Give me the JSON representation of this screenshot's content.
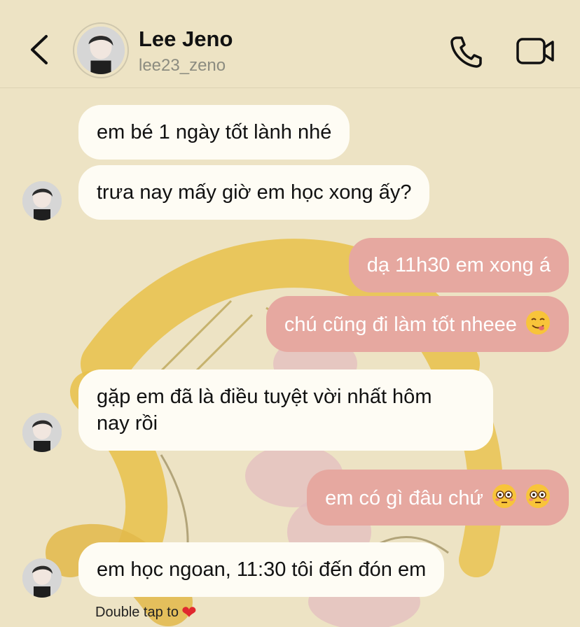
{
  "header": {
    "name": "Lee Jeno",
    "username": "lee23_zeno"
  },
  "messages": [
    {
      "side": "in",
      "text": "em bé 1 ngày tốt lành nhé"
    },
    {
      "side": "in",
      "text": "trưa nay mấy giờ em học xong ấy?"
    },
    {
      "side": "out",
      "text": "dạ 11h30 em xong á"
    },
    {
      "side": "out",
      "text": "chú cũng đi làm tốt nheee",
      "emoji": "yum-face-emoji"
    },
    {
      "side": "in",
      "text_line1": "gặp em đã là điều tuyệt vời nhất hôm",
      "text_line2": "nay rồi"
    },
    {
      "side": "out",
      "text": "em có gì đâu chứ",
      "emoji": "flushed-face-emoji"
    },
    {
      "side": "in",
      "text": "em học ngoan, 11:30 tôi đến đón em"
    }
  ],
  "footer": {
    "double_tap_label": "Double tap to",
    "heart_icon": "heart-icon"
  },
  "icons": [
    "back-chevron-icon",
    "phone-icon",
    "video-camera-icon"
  ],
  "colors": {
    "background": "#ede3c4",
    "incoming_bubble": "#fefcf4",
    "outgoing_bubble": "#e6a8a0",
    "heart": "#e0282e"
  }
}
